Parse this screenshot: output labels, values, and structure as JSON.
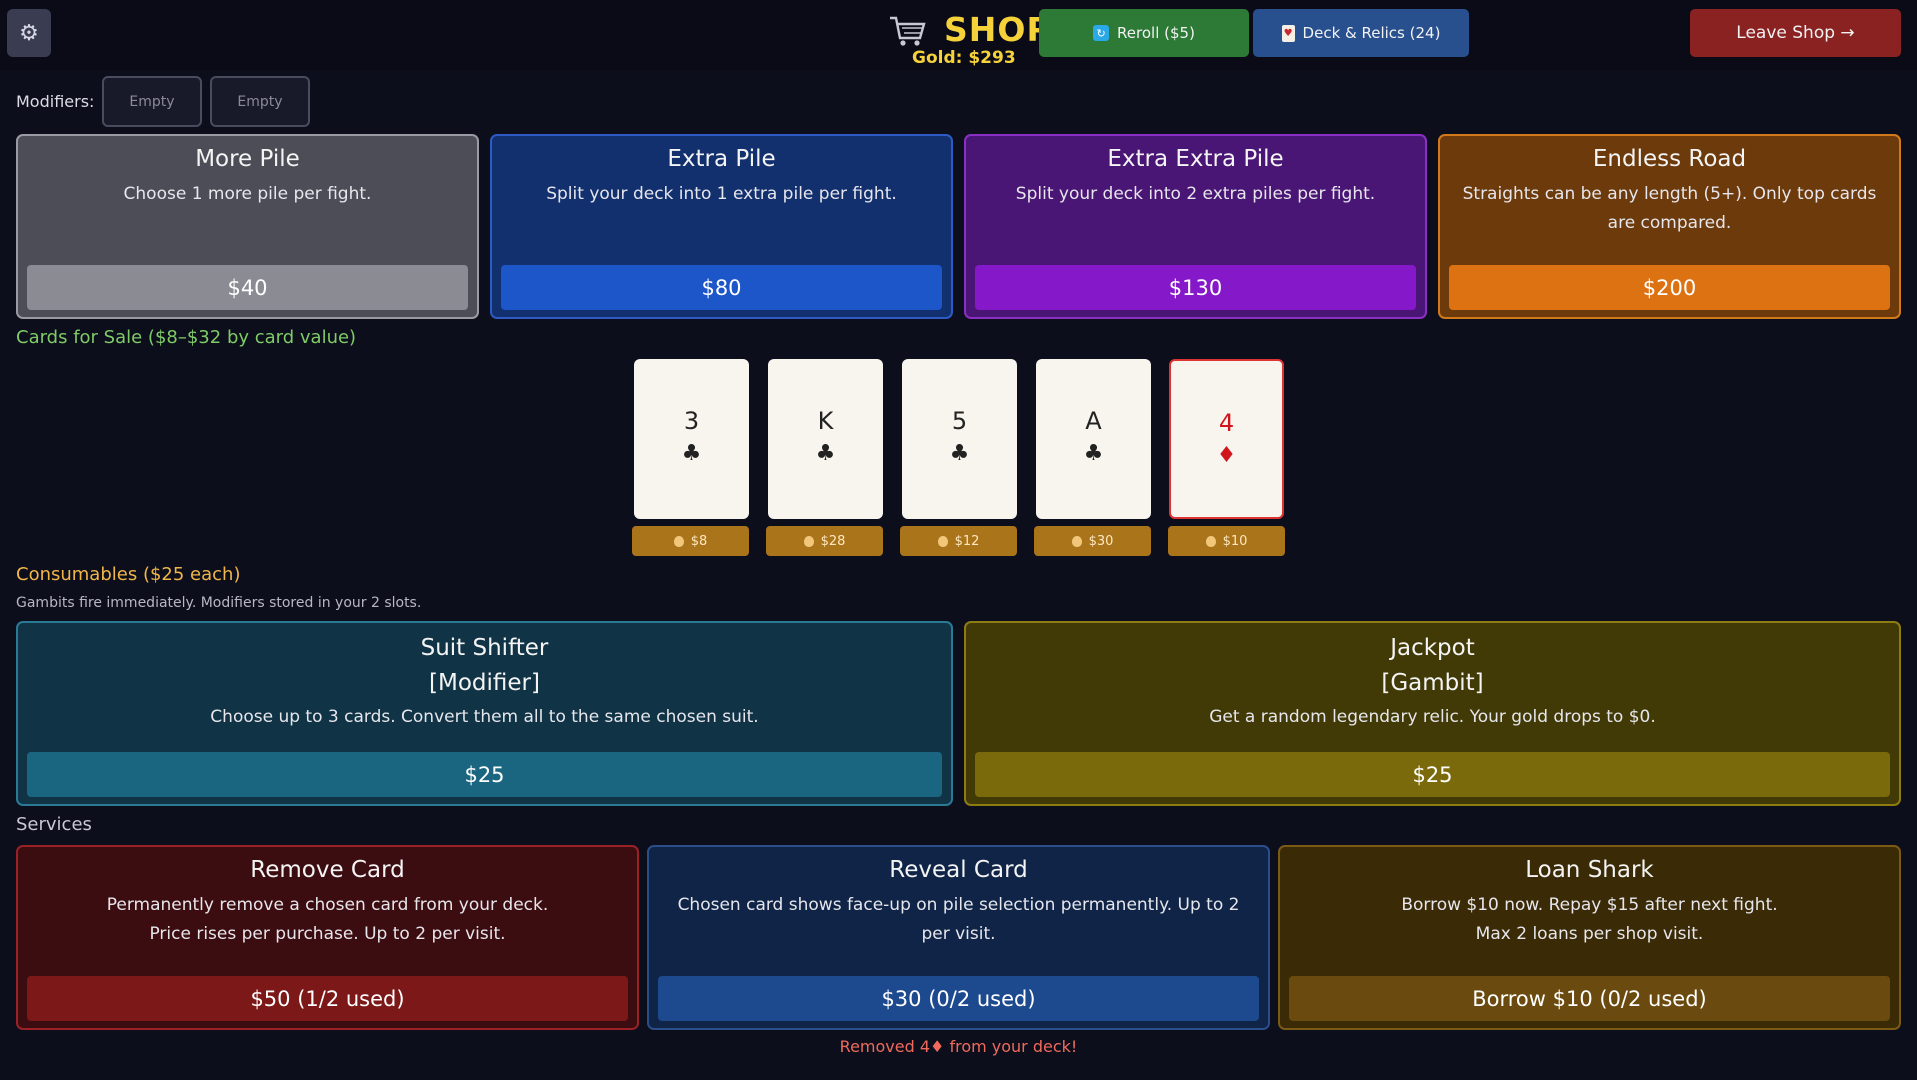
{
  "header": {
    "settings_icon": "gear-icon",
    "title": "SHOP",
    "gold_label": "Gold:  $293",
    "reroll_label": "Reroll ($5)",
    "deck_label": "Deck & Relics (24)",
    "leave_label": "Leave Shop →"
  },
  "modifiers": {
    "label": "Modifiers:",
    "slots": [
      "Empty",
      "Empty"
    ]
  },
  "relics": [
    {
      "name": "More Pile",
      "desc": "Choose 1 more pile per fight.",
      "price": "$40"
    },
    {
      "name": "Extra Pile",
      "desc": "Split your deck into 1 extra pile per fight.",
      "price": "$80"
    },
    {
      "name": "Extra Extra Pile",
      "desc": "Split your deck into 2 extra piles per fight.",
      "price": "$130"
    },
    {
      "name": "Endless Road",
      "desc": "Straights can be any length (5+). Only top cards are compared.",
      "price": "$200"
    }
  ],
  "cards_section": {
    "label": "Cards for Sale  ($8–$32 by card value)",
    "cards": [
      {
        "rank": "3",
        "suit": "♣",
        "price": "$8"
      },
      {
        "rank": "K",
        "suit": "♣",
        "price": "$28"
      },
      {
        "rank": "5",
        "suit": "♣",
        "price": "$12"
      },
      {
        "rank": "A",
        "suit": "♣",
        "price": "$30"
      },
      {
        "rank": "4",
        "suit": "♦",
        "price": "$10"
      }
    ]
  },
  "consumables": {
    "label": "Consumables  ($25 each)",
    "sub": "Gambits fire immediately. Modifiers stored in your 2 slots.",
    "items": [
      {
        "name": "Suit Shifter",
        "kind": "[Modifier]",
        "desc": "Choose up to 3 cards. Convert them all to the same chosen suit.",
        "price": "$25"
      },
      {
        "name": "Jackpot",
        "kind": "[Gambit]",
        "desc": "Get a random legendary relic. Your gold drops to $0.",
        "price": "$25"
      }
    ]
  },
  "services": {
    "label": "Services",
    "items": [
      {
        "name": "Remove Card",
        "desc1": "Permanently remove a chosen card from your deck.",
        "desc2": "Price rises per purchase. Up to 2 per visit.",
        "price": "$50  (1/2 used)"
      },
      {
        "name": "Reveal Card",
        "desc1": "Chosen card shows face-up on pile selection permanently. Up to 2 per visit.",
        "desc2": "",
        "price": "$30  (0/2 used)"
      },
      {
        "name": "Loan Shark",
        "desc1": "Borrow $10 now. Repay $15 after next fight.",
        "desc2": "Max 2 loans per shop visit.",
        "price": "Borrow $10  (0/2 used)"
      }
    ]
  },
  "notice": "Removed 4♦ from your deck!"
}
